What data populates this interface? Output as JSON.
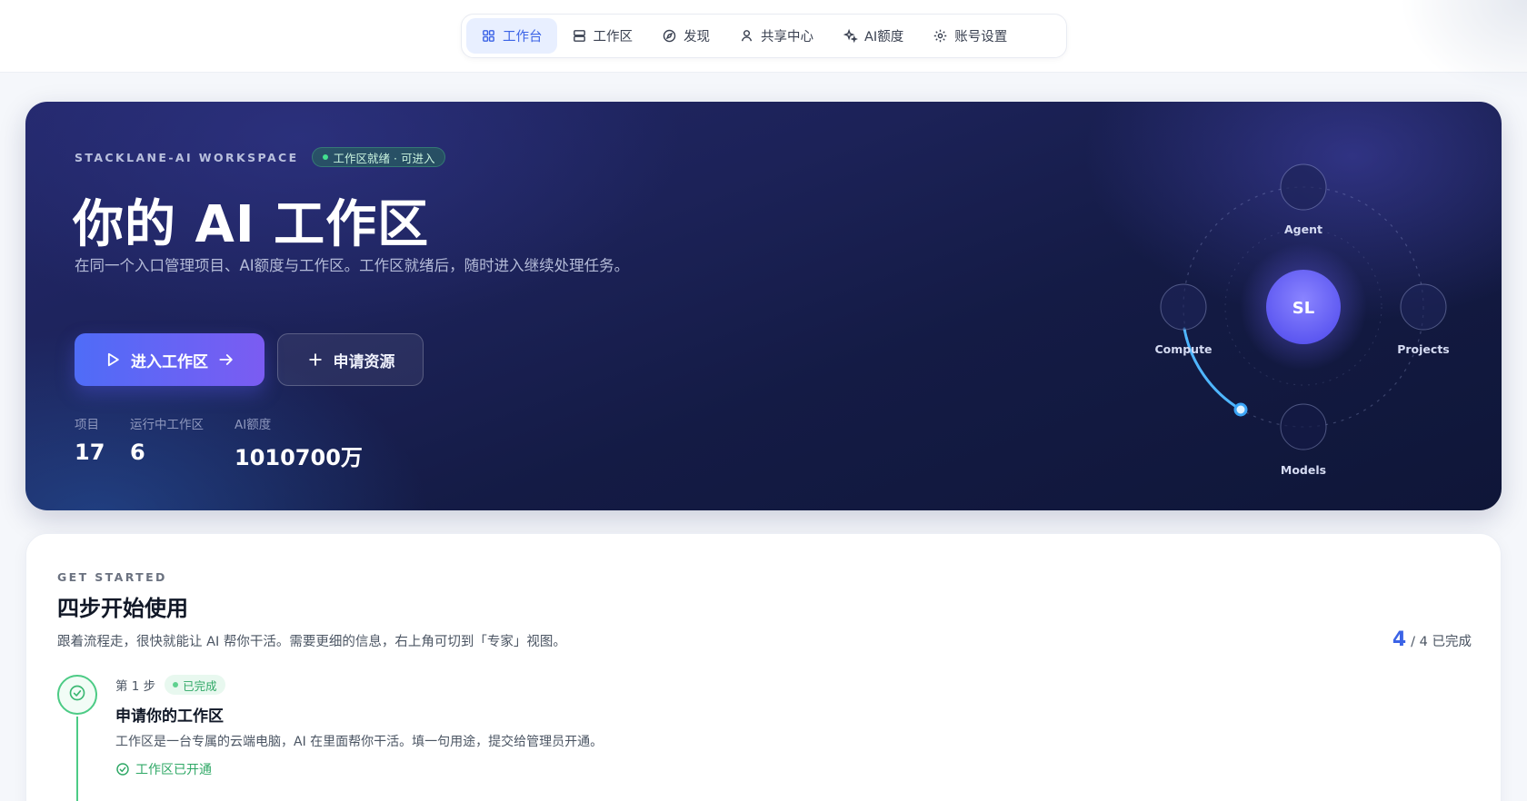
{
  "nav": {
    "items": [
      {
        "label": "工作台",
        "icon": "grid-icon",
        "active": true
      },
      {
        "label": "工作区",
        "icon": "server-icon",
        "active": false
      },
      {
        "label": "发现",
        "icon": "compass-icon",
        "active": false
      },
      {
        "label": "共享中心",
        "icon": "user-icon",
        "active": false
      },
      {
        "label": "AI额度",
        "icon": "sparkles-icon",
        "active": false
      },
      {
        "label": "账号设置",
        "icon": "gear-icon",
        "active": false
      }
    ]
  },
  "hero": {
    "eyebrow": "STACKLANE-AI WORKSPACE",
    "badge": "工作区就绪 · 可进入",
    "title": "你的 AI 工作区",
    "description": "在同一个入口管理项目、AI额度与工作区。工作区就绪后，随时进入继续处理任务。",
    "primary_button": "进入工作区",
    "secondary_button": "申请资源",
    "stats": [
      {
        "label": "项目",
        "value": "17"
      },
      {
        "label": "运行中工作区",
        "value": "6"
      },
      {
        "label": "AI额度",
        "value": "1010700万"
      }
    ],
    "orbit": {
      "center": "SL",
      "nodes": [
        "Agent",
        "Projects",
        "Models",
        "Compute"
      ]
    },
    "colors": {
      "accent_start": "#4f6cf7",
      "accent_end": "#7b5cf2",
      "ready": "#43e08f"
    }
  },
  "get_started": {
    "eyebrow": "GET STARTED",
    "title": "四步开始使用",
    "description": "跟着流程走，很快就能让 AI 帮你干活。需要更细的信息，右上角可切到「专家」视图。",
    "progress_done": "4",
    "progress_total": "/ 4 已完成",
    "steps": [
      {
        "number_label": "第 1 步",
        "badge": "已完成",
        "title": "申请你的工作区",
        "description": "工作区是一台专属的云端电脑，AI 在里面帮你干活。填一句用途，提交给管理员开通。",
        "status": "工作区已开通"
      }
    ],
    "colors": {
      "done": "#2fa866",
      "progress": "#3b63e6"
    }
  }
}
